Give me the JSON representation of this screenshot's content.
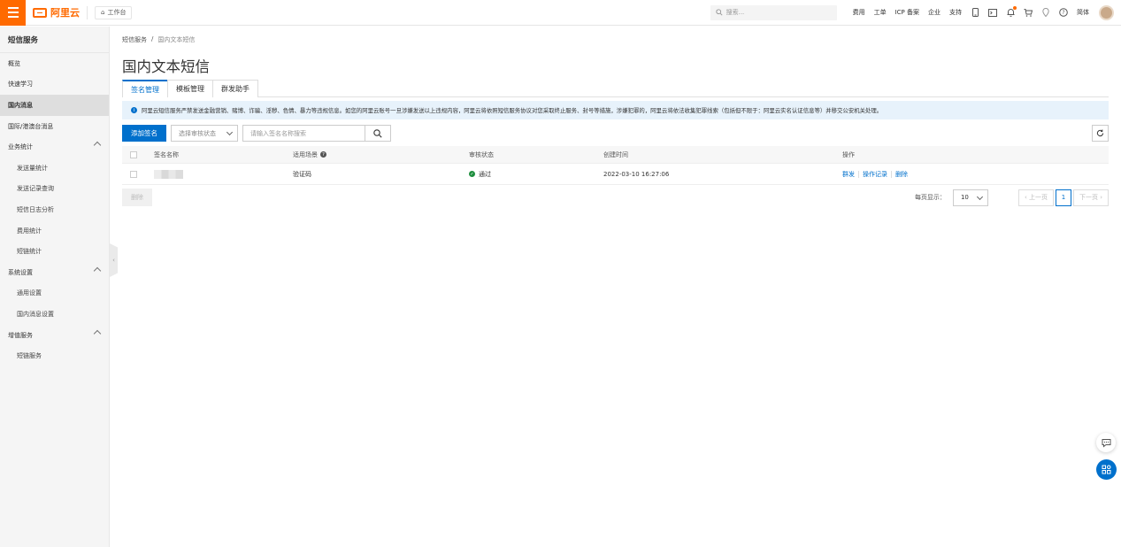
{
  "topbar": {
    "logo_text": "阿里云",
    "workbench_label": "工作台",
    "search_placeholder": "搜索...",
    "links": [
      "费用",
      "工单",
      "ICP 备案",
      "企业",
      "支持"
    ],
    "lang": "简体",
    "icons": [
      "menu-icon",
      "home-icon",
      "search-icon",
      "mobile-icon",
      "terminal-icon",
      "bell-icon",
      "cart-icon",
      "location-icon",
      "help-icon"
    ]
  },
  "sidebar": {
    "title": "短信服务",
    "items": [
      {
        "label": "概览"
      },
      {
        "label": "快速学习"
      },
      {
        "label": "国内消息"
      },
      {
        "label": "国际/港澳台消息"
      },
      {
        "label": "业务统计"
      },
      {
        "label": "发送量统计"
      },
      {
        "label": "发送记录查询"
      },
      {
        "label": "短信日志分析"
      },
      {
        "label": "费用统计"
      },
      {
        "label": "短链统计"
      },
      {
        "label": "系统设置"
      },
      {
        "label": "通用设置"
      },
      {
        "label": "国内消息设置"
      },
      {
        "label": "增值服务"
      },
      {
        "label": "短链服务"
      }
    ]
  },
  "breadcrumb": {
    "root": "短信服务",
    "sep": "/",
    "current": "国内文本短信"
  },
  "page_title": "国内文本短信",
  "tabs": [
    "签名管理",
    "模板管理",
    "群发助手"
  ],
  "notice": "阿里云短信服务严禁发送金融营销、赌博、诈骗、淫秽、色情、暴力等违规信息。如您的阿里云账号一旦涉嫌发送以上违规内容，阿里云将依照短信服务协议对您采取终止服务、封号等措施，涉嫌犯罪的，阿里云将依法收集犯罪线索（包括但不限于：阿里云实名认证信息等）并移交公安机关处理。",
  "toolbar": {
    "add_label": "添加签名",
    "status_placeholder": "选择审核状态",
    "search_placeholder": "请输入签名名称搜索"
  },
  "table": {
    "headers": [
      "签名名称",
      "适用场景",
      "审核状态",
      "创建时间",
      "操作"
    ],
    "rows": [
      {
        "scene": "验证码",
        "status": "通过",
        "created": "2022-03-10 16:27:06",
        "ops": [
          "群发",
          "操作记录",
          "删除"
        ]
      }
    ]
  },
  "footer": {
    "delete_label": "删除",
    "page_size_label": "每页显示：",
    "page_size": "10",
    "prev": "上一页",
    "current_page": "1",
    "next": "下一页"
  },
  "colors": {
    "brand": "#ff6a00",
    "primary": "#0070cc",
    "success": "#1e8e3e"
  }
}
